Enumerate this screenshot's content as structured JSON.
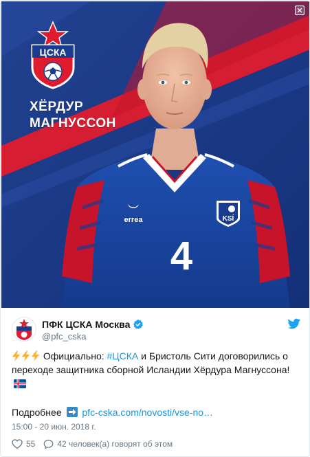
{
  "media": {
    "player_first_name": "ХЁРДУР",
    "player_last_name": "МАГНУССОН",
    "club_logo_text": "ЦСКА",
    "jersey_number": "4",
    "jersey_brand": "errea",
    "badge_text": "KSÍ"
  },
  "author": {
    "name": "ПФК ЦСКА Москва",
    "handle": "@pfc_cska"
  },
  "tweet": {
    "intro": "Официально: ",
    "hashtag": "#ЦСКА",
    "body": " и Бристоль Сити договорились о переходе защитника сборной Исландии Хёрдура Магнуссона! ",
    "more_label": "Подробнее",
    "link_text": "pfc-cska.com/novosti/vse-no…"
  },
  "meta": {
    "timestamp": "15:00 - 20 июн. 2018 г."
  },
  "actions": {
    "likes": "55",
    "talking": "42 человек(а) говорят об этом"
  },
  "colors": {
    "link": "#1b95e0",
    "text": "#14171a",
    "secondary": "#657786",
    "like": "#e0245e",
    "twitter_brand": "#1da1f2",
    "banner_blue": "#1a3c8f",
    "banner_red": "#e01b2d"
  },
  "icons": [
    "expand-icon",
    "verified-icon",
    "twitter-bird-icon",
    "zap-icon",
    "iceland-flag-icon",
    "right-arrow-icon",
    "heart-icon",
    "speech-bubble-icon"
  ]
}
